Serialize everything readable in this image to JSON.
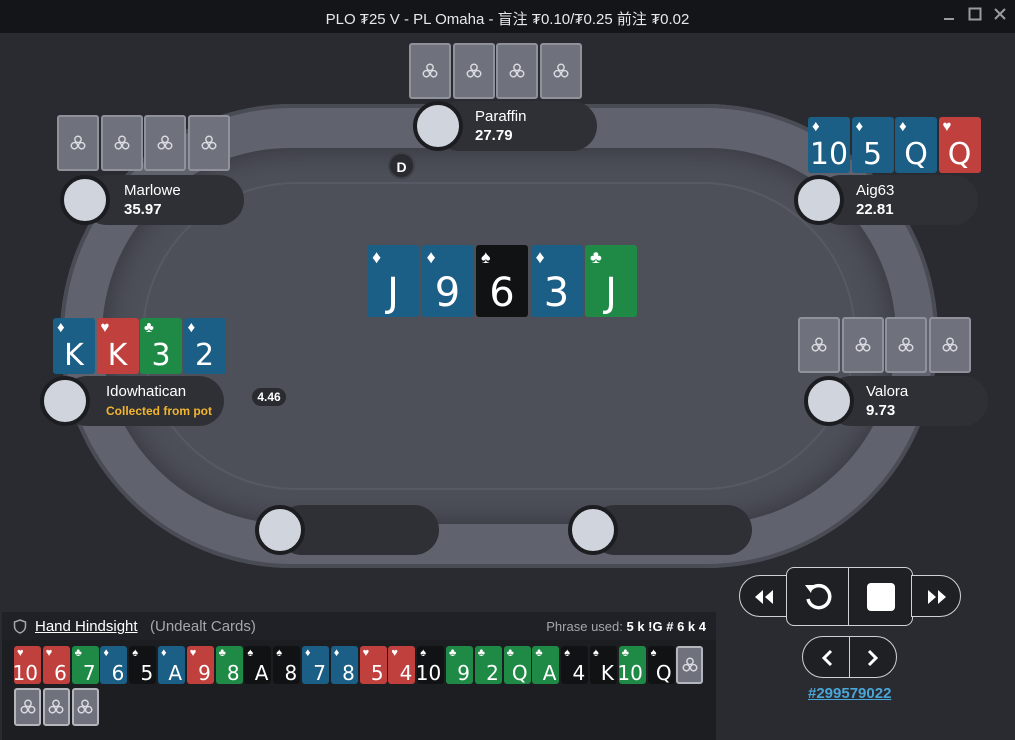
{
  "window": {
    "title": "PLO ₮25 V - PL Omaha - 盲注 ₮0.10/₮0.25 前注 ₮0.02",
    "controls": [
      "minimize",
      "maximize",
      "close"
    ]
  },
  "table": {
    "dealer_button": "D",
    "pot_chip": "4.46",
    "board": [
      {
        "rank": "J",
        "suit": "diamonds"
      },
      {
        "rank": "9",
        "suit": "diamonds"
      },
      {
        "rank": "6",
        "suit": "spades"
      },
      {
        "rank": "3",
        "suit": "diamonds"
      },
      {
        "rank": "J",
        "suit": "clubs"
      }
    ]
  },
  "seats": [
    {
      "id": "paraffin",
      "name": "Paraffin",
      "stack": "27.79"
    },
    {
      "id": "marlowe",
      "name": "Marlowe",
      "stack": "35.97"
    },
    {
      "id": "aig63",
      "name": "Aig63",
      "stack": "22.81",
      "cards": [
        {
          "rank": "10",
          "suit": "diamonds"
        },
        {
          "rank": "5",
          "suit": "diamonds"
        },
        {
          "rank": "Q",
          "suit": "diamonds"
        },
        {
          "rank": "Q",
          "suit": "hearts"
        }
      ]
    },
    {
      "id": "idowhatican",
      "name": "Idowhatican",
      "status": "Collected from pot",
      "cards": [
        {
          "rank": "K",
          "suit": "diamonds"
        },
        {
          "rank": "K",
          "suit": "hearts"
        },
        {
          "rank": "3",
          "suit": "clubs"
        },
        {
          "rank": "2",
          "suit": "diamonds"
        }
      ]
    },
    {
      "id": "valora",
      "name": "Valora",
      "stack": "9.73"
    },
    {
      "id": "empty1",
      "name": "",
      "stack": ""
    },
    {
      "id": "empty2",
      "name": "",
      "stack": ""
    }
  ],
  "hindsight": {
    "title": "Hand Hindsight",
    "subtitle": "(Undealt Cards)",
    "phrase_label": "Phrase used:",
    "phrase_value": "5 k !G # 6 k 4",
    "cards": [
      {
        "rank": "10",
        "suit": "hearts"
      },
      {
        "rank": "6",
        "suit": "hearts"
      },
      {
        "rank": "7",
        "suit": "clubs"
      },
      {
        "rank": "6",
        "suit": "diamonds"
      },
      {
        "rank": "5",
        "suit": "spades"
      },
      {
        "rank": "A",
        "suit": "diamonds"
      },
      {
        "rank": "9",
        "suit": "hearts"
      },
      {
        "rank": "8",
        "suit": "clubs"
      },
      {
        "rank": "A",
        "suit": "spades"
      },
      {
        "rank": "8",
        "suit": "spades"
      },
      {
        "rank": "7",
        "suit": "diamonds"
      },
      {
        "rank": "8",
        "suit": "diamonds"
      },
      {
        "rank": "5",
        "suit": "hearts"
      },
      {
        "rank": "4",
        "suit": "hearts"
      },
      {
        "rank": "10",
        "suit": "spades"
      },
      {
        "rank": "9",
        "suit": "clubs"
      },
      {
        "rank": "2",
        "suit": "clubs"
      },
      {
        "rank": "Q",
        "suit": "clubs"
      },
      {
        "rank": "A",
        "suit": "clubs"
      },
      {
        "rank": "4",
        "suit": "spades"
      },
      {
        "rank": "K",
        "suit": "spades"
      },
      {
        "rank": "10",
        "suit": "clubs"
      },
      {
        "rank": "Q",
        "suit": "spades"
      },
      {
        "rank": "",
        "suit": "back"
      },
      {
        "rank": "",
        "suit": "back"
      },
      {
        "rank": "",
        "suit": "back"
      },
      {
        "rank": "",
        "suit": "back"
      }
    ]
  },
  "replay": {
    "rewind_icon": "rewind-icon",
    "replay_icon": "replay-icon",
    "stop_icon": "stop-icon",
    "fast_forward_icon": "fast-forward-icon",
    "prev_icon": "chevron-left-icon",
    "next_icon": "chevron-right-icon",
    "hand_id": "#299579022"
  },
  "colors": {
    "diamonds": "#1b5e86",
    "hearts": "#c0403e",
    "clubs": "#1f8a45",
    "spades": "#111214",
    "status": "#f2b52c",
    "link": "#4aa6d8"
  }
}
